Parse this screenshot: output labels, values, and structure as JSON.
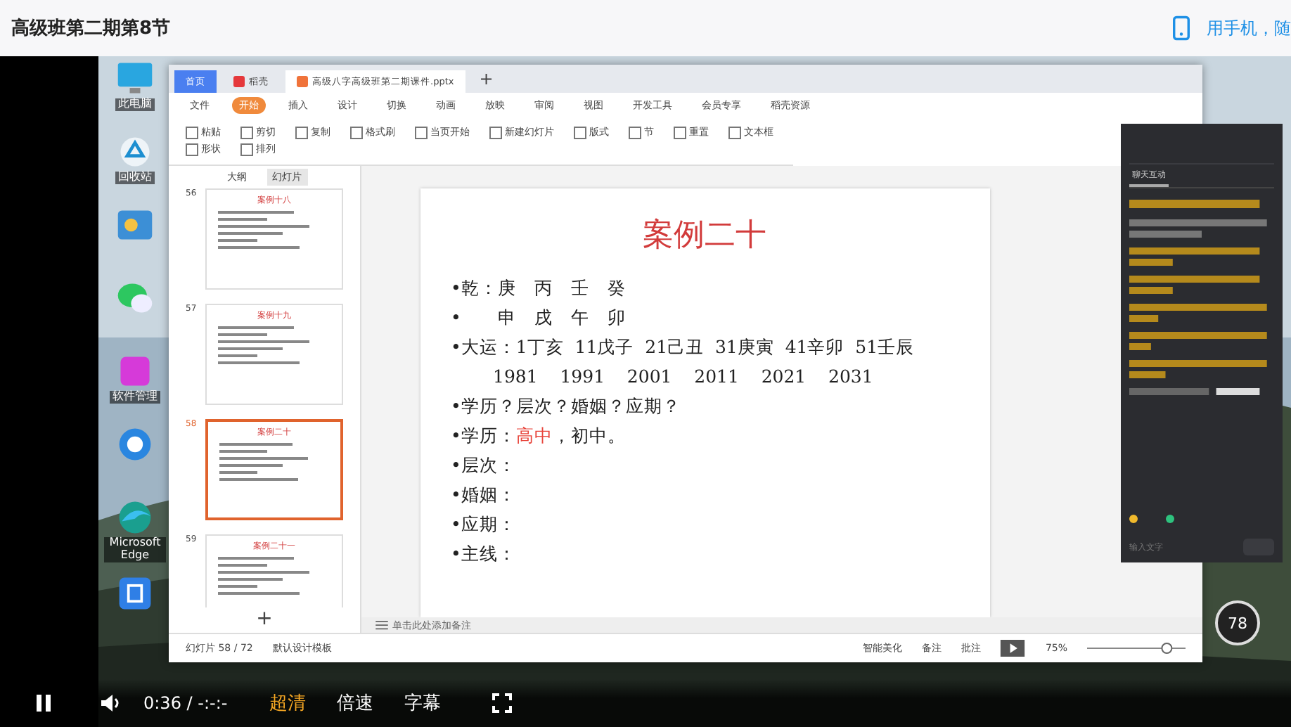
{
  "page": {
    "title": "高级班第二期第8节",
    "mobile_link": "用手机，随"
  },
  "desktop_icons": [
    {
      "kind": "monitor",
      "label": "此电脑"
    },
    {
      "kind": "recycle",
      "label": "回收站"
    },
    {
      "kind": "panel"
    },
    {
      "kind": "chat"
    },
    {
      "kind": "store",
      "label": "软件管理"
    },
    {
      "kind": "browser"
    },
    {
      "kind": "edge",
      "label": "Microsoft Edge"
    },
    {
      "kind": "cloud"
    }
  ],
  "wps": {
    "tabs": [
      {
        "kind": "home",
        "label": "首页",
        "selected": false
      },
      {
        "kind": "docer",
        "label": "稻壳",
        "selected": false
      },
      {
        "kind": "doc",
        "label": "高级八字高级班第二期课件.pptx",
        "selected": true
      }
    ],
    "menu": [
      {
        "label": "文件",
        "selected": false
      },
      {
        "label": "开始",
        "selected": true
      },
      {
        "label": "插入",
        "selected": false
      },
      {
        "label": "设计",
        "selected": false
      },
      {
        "label": "切换",
        "selected": false
      },
      {
        "label": "动画",
        "selected": false
      },
      {
        "label": "放映",
        "selected": false
      },
      {
        "label": "审阅",
        "selected": false
      },
      {
        "label": "视图",
        "selected": false
      },
      {
        "label": "开发工具",
        "selected": false
      },
      {
        "label": "会员专享",
        "selected": false
      },
      {
        "label": "稻壳资源",
        "selected": false
      }
    ],
    "ribbon": [
      "粘贴",
      "剪切",
      "复制",
      "格式刷",
      "当页开始",
      "新建幻灯片",
      "版式",
      "节",
      "重置",
      "文本框",
      "形状",
      "排列"
    ],
    "panel_tabs": [
      {
        "label": "大纲",
        "selected": false
      },
      {
        "label": "幻灯片",
        "selected": true
      }
    ],
    "thumbnails": [
      {
        "number": "56",
        "title": "案例十八",
        "selected": false
      },
      {
        "number": "57",
        "title": "案例十九",
        "selected": false
      },
      {
        "number": "58",
        "title": "案例二十",
        "selected": true
      },
      {
        "number": "59",
        "title": "案例二十一",
        "selected": false
      }
    ],
    "slide": {
      "title": "案例二十",
      "lines": [
        {
          "bullet": "•",
          "parts": [
            {
              "text": "乾：庚　丙　壬　癸",
              "accent": false
            }
          ]
        },
        {
          "bullet": "•",
          "parts": [
            {
              "text": "　　申　戌　午　卯",
              "accent": false
            }
          ]
        },
        {
          "bullet": "•",
          "parts": [
            {
              "text": "大运：1丁亥  11戊子  21己丑  31庚寅  41辛卯  51壬辰",
              "accent": false
            }
          ]
        },
        {
          "parts": [
            {
              "text": "1981    1991    2001    2011    2021    2031",
              "accent": false
            }
          ]
        },
        {
          "bullet": "•",
          "parts": [
            {
              "text": "学历？层次？婚姻？应期？",
              "accent": false
            }
          ]
        },
        {
          "bullet": "•",
          "parts": [
            {
              "text": "学历：",
              "accent": false
            },
            {
              "text": "高中",
              "accent": true
            },
            {
              "text": "，初中。",
              "accent": false
            }
          ]
        },
        {
          "bullet": "•",
          "parts": [
            {
              "text": "层次：",
              "accent": false
            }
          ]
        },
        {
          "bullet": "•",
          "parts": [
            {
              "text": "婚姻：",
              "accent": false
            }
          ]
        },
        {
          "bullet": "•",
          "parts": [
            {
              "text": "应期：",
              "accent": false
            }
          ]
        },
        {
          "bullet": "•",
          "parts": [
            {
              "text": "主线：",
              "accent": false
            }
          ]
        }
      ]
    },
    "new_tab": "+",
    "add_slide": "+",
    "notes_placeholder": "单击此处添加备注",
    "status": {
      "slide_count": "幻灯片 58 / 72",
      "template": "默认设计模板",
      "beautify": "智能美化",
      "notes": "备注",
      "comments": "批注",
      "zoom": "75%",
      "zoom_slider": {
        "level": 0.85
      }
    }
  },
  "chat": {
    "tabs": [
      {
        "label": "聊天互动",
        "selected": true
      }
    ],
    "input_placeholder": "输入文字"
  },
  "widget": {
    "percent": "78"
  },
  "player": {
    "playing": true,
    "time": "0:36 / -:-:-",
    "quality": "超清",
    "speed": "倍速",
    "subtitles": "字幕"
  }
}
